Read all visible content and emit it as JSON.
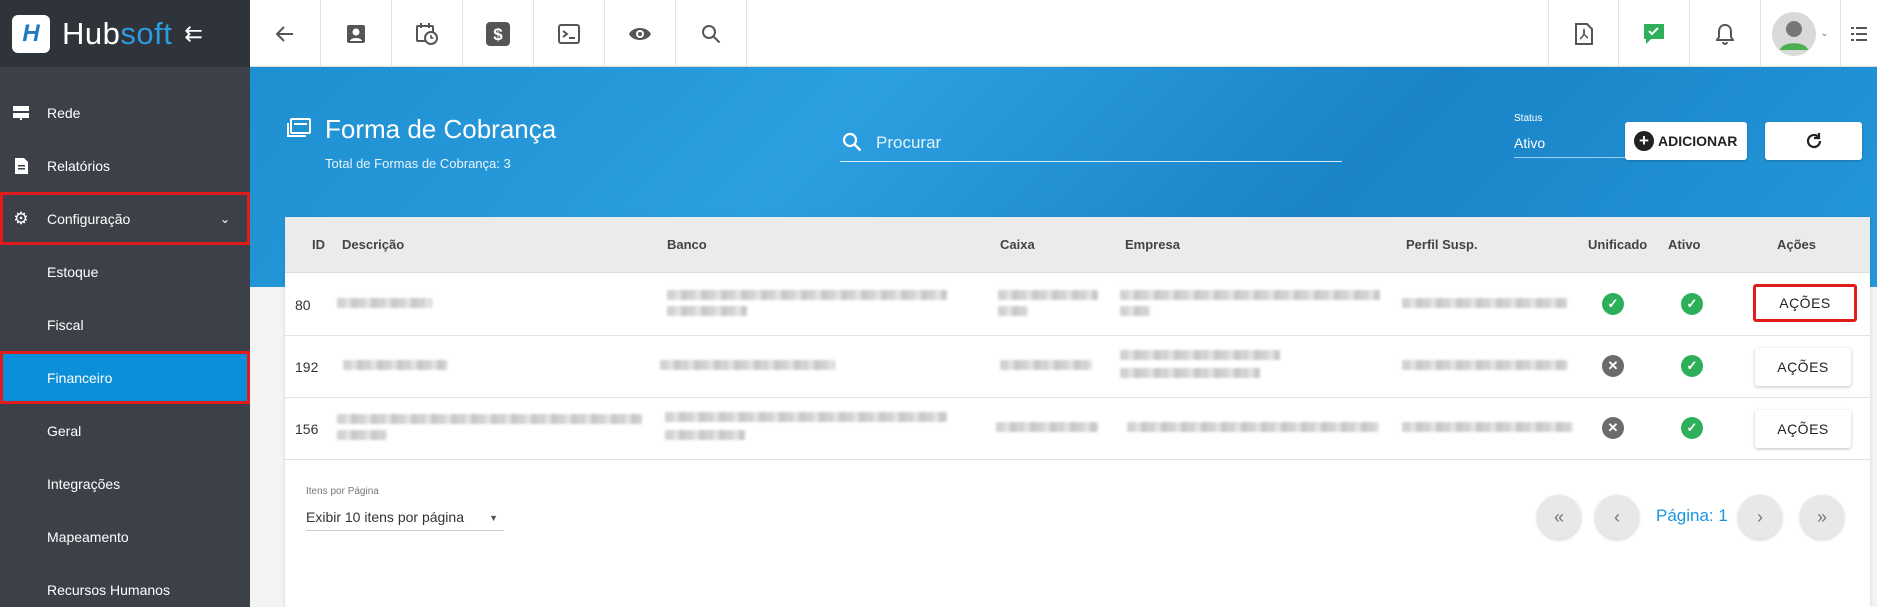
{
  "brand": {
    "hub": "Hub",
    "soft": "soft",
    "collapse_icon": "arrow-collapse-left-icon"
  },
  "sidebar": {
    "items": [
      {
        "label": "Rede",
        "icon": "server-icon"
      },
      {
        "label": "Relatórios",
        "icon": "document-icon"
      },
      {
        "label": "Configuração",
        "icon": "gear-icon"
      },
      {
        "label": "Estoque"
      },
      {
        "label": "Fiscal"
      },
      {
        "label": "Financeiro"
      },
      {
        "label": "Geral"
      },
      {
        "label": "Integrações"
      },
      {
        "label": "Mapeamento"
      },
      {
        "label": "Recursos Humanos"
      }
    ]
  },
  "topbar": {
    "icons": [
      "back-arrow-icon",
      "contact-card-icon",
      "calendar-clock-icon",
      "dollar-icon",
      "terminal-icon",
      "eye-icon",
      "search-icon",
      "pdf-icon",
      "chat-check-icon",
      "bell-icon",
      "avatar",
      "menu-list-icon"
    ]
  },
  "header": {
    "title": "Forma de Cobrança",
    "subtitle": "Total de Formas de Cobrança: 3",
    "search_placeholder": "Procurar",
    "status_label": "Status",
    "status_value": "Ativo",
    "add_label": "ADICIONAR"
  },
  "table": {
    "columns": [
      "ID",
      "Descrição",
      "Banco",
      "Caixa",
      "Empresa",
      "Perfil Susp.",
      "Unificado",
      "Ativo",
      "Ações"
    ],
    "rows": [
      {
        "id": "80",
        "unificado": true,
        "ativo": true,
        "action": "AÇÕES"
      },
      {
        "id": "192",
        "unificado": false,
        "ativo": true,
        "action": "AÇÕES"
      },
      {
        "id": "156",
        "unificado": false,
        "ativo": true,
        "action": "AÇÕES"
      }
    ]
  },
  "pagination": {
    "per_page_label": "Itens por Página",
    "per_page_value": "Exibir 10 itens por página",
    "page_label": "Página: 1"
  },
  "colors": {
    "accent": "#0a8fd8",
    "highlight": "#e01b1b",
    "sidebar": "#3c4048"
  }
}
